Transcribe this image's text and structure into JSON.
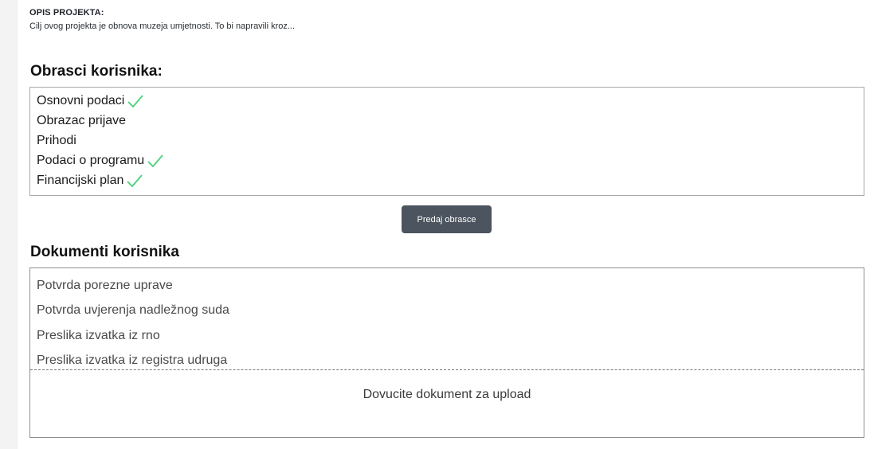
{
  "project": {
    "description_label": "OPIS PROJEKTA:",
    "description_text": "Cilj ovog projekta je obnova muzeja umjetnosti. To bi napravili kroz..."
  },
  "forms_section": {
    "title": "Obrasci korisnika:",
    "items": [
      {
        "label": "Osnovni podaci",
        "completed": true
      },
      {
        "label": "Obrazac prijave",
        "completed": false
      },
      {
        "label": "Prihodi",
        "completed": false
      },
      {
        "label": "Podaci o programu",
        "completed": true
      },
      {
        "label": "Financijski plan",
        "completed": true
      }
    ],
    "check_icon": "check-icon",
    "check_color": "#4cd07d"
  },
  "submit": {
    "label": "Predaj obrasce",
    "background": "#4b545f"
  },
  "documents_section": {
    "title": "Dokumenti korisnika",
    "items": [
      {
        "label": "Potvrda porezne uprave"
      },
      {
        "label": "Potvrda uvjerenja nadležnog suda"
      },
      {
        "label": "Preslika izvatka iz rno"
      },
      {
        "label": "Preslika izvatka iz registra udruga"
      }
    ],
    "dropzone_text": "Dovucite dokument za upload"
  }
}
